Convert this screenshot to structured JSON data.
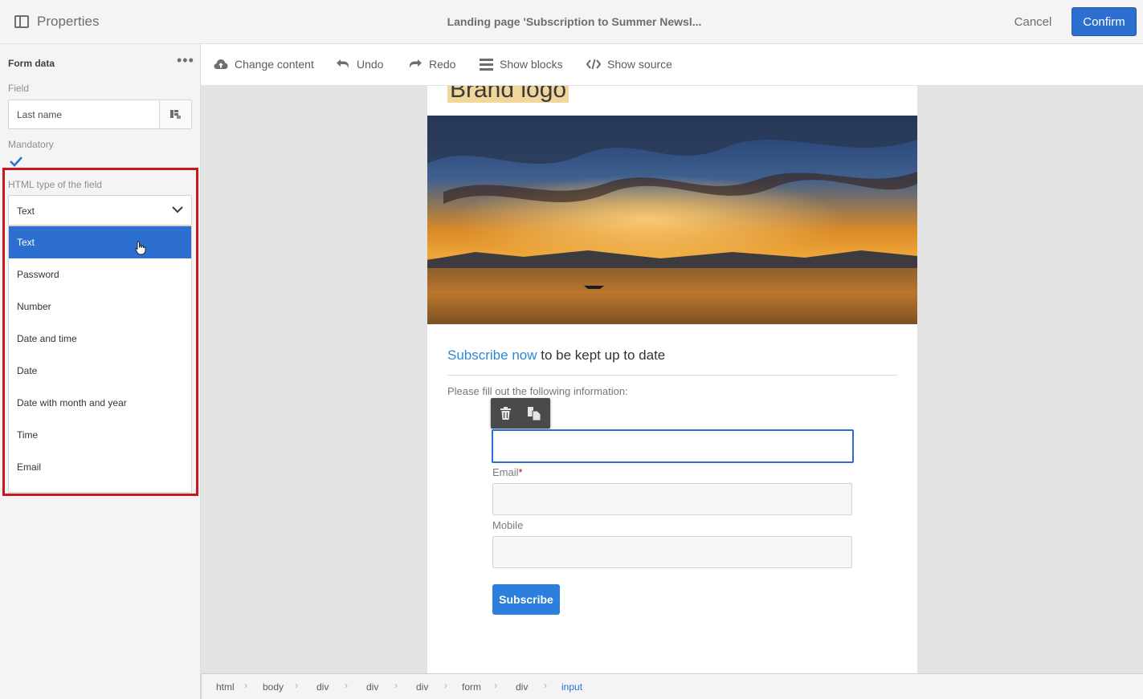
{
  "header": {
    "title": "Properties",
    "center_title": "Landing page 'Subscription to Summer Newsl...",
    "cancel_label": "Cancel",
    "confirm_label": "Confirm"
  },
  "left_panel": {
    "section_title": "Form data",
    "field_label": "Field",
    "field_value": "Last name",
    "mandatory_label": "Mandatory",
    "mandatory_checked": true,
    "html_type_label": "HTML type of the field",
    "html_type_value": "Text",
    "options": [
      "Text",
      "Password",
      "Number",
      "Date and time",
      "Date",
      "Date with month and year",
      "Time",
      "Email"
    ],
    "selected_option": "Text"
  },
  "toolbar": {
    "change_content": "Change content",
    "undo": "Undo",
    "redo": "Redo",
    "show_blocks": "Show blocks",
    "show_source": "Show source"
  },
  "page": {
    "logo_text": "Brand logo",
    "headline_accent": "Subscribe now",
    "headline_rest": " to be kept up to date",
    "instructions": "Please fill out the following information:",
    "email_label": "Email",
    "email_required_mark": "*",
    "mobile_label": "Mobile",
    "subscribe_label": "Subscribe"
  },
  "breadcrumb": [
    "html",
    "body",
    "div",
    "div",
    "div",
    "form",
    "div",
    "input"
  ],
  "colors": {
    "accent": "#2c6fd0",
    "highlight": "#c8161d",
    "link": "#2f86d6"
  }
}
